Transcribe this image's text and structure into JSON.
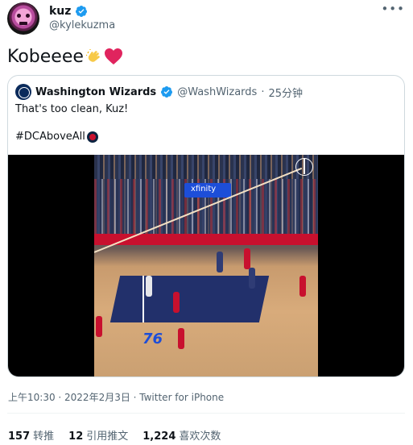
{
  "tweet": {
    "display_name": "kuz",
    "handle": "@kylekuzma",
    "text": "Kobeeee",
    "emojis": [
      "clapping-hands-icon",
      "red-heart-icon"
    ],
    "timestamp": "上午10:30 · 2022年2月3日 · Twitter for iPhone"
  },
  "quoted_tweet": {
    "display_name": "Washington Wizards",
    "handle": "@WashWizards",
    "separator": "·",
    "time": "25分钟",
    "text": "That's too clean, Kuz!",
    "hashtag": "#DCAboveAll",
    "banner_text": "xfinity",
    "court_logo": "76"
  },
  "stats": [
    {
      "count": "157",
      "label": "转推"
    },
    {
      "count": "12",
      "label": "引用推文"
    },
    {
      "count": "1,224",
      "label": "喜欢次数"
    }
  ],
  "colors": {
    "verified_blue": "#1d9bf0",
    "secondary_text": "#536471",
    "primary_text": "#0f1419",
    "border": "#cfd9de"
  }
}
